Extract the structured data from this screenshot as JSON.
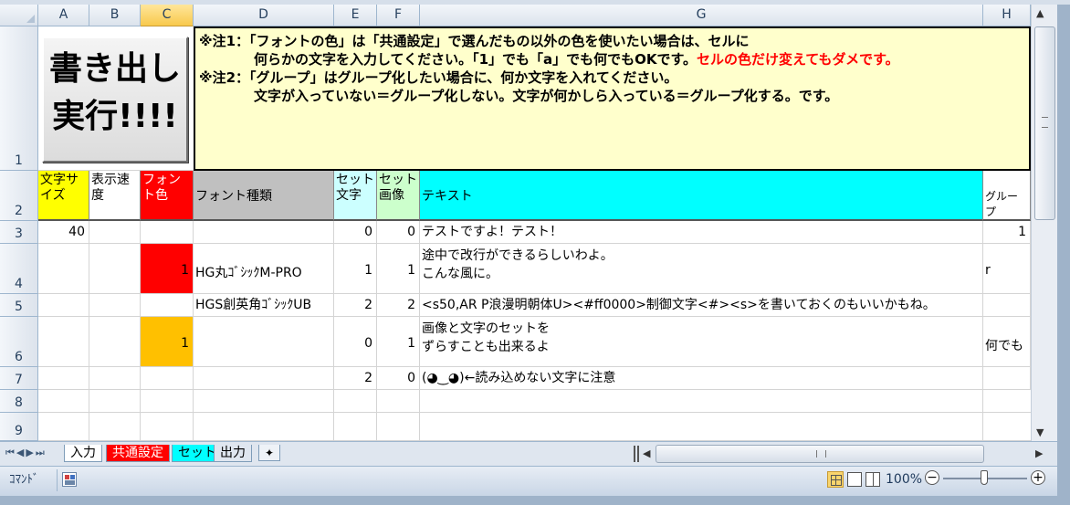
{
  "columns": [
    "A",
    "B",
    "C",
    "D",
    "E",
    "F",
    "G",
    "H"
  ],
  "rows": [
    "1",
    "2",
    "3",
    "4",
    "5",
    "6",
    "7",
    "8",
    "9"
  ],
  "button": {
    "line1": "書き出し",
    "line2": "実行!!!!"
  },
  "notes": {
    "line1": "※注1：「フォントの色」は「共通設定」で選んだもの以外の色を使いたい場合は、セルに",
    "line2a": "　　　　何らかの文字を入力してください。「1」でも「a」でも何でもOKです。",
    "line2b": "セルの色だけ変えてもダメです。",
    "line3": "※注2：「グループ」はグループ化したい場合に、何か文字を入れてください。",
    "line4": "　　　　文字が入っていない＝グループ化しない。文字が何かしら入っている＝グループ化する。です。"
  },
  "headers": {
    "a": "文字サイズ",
    "b": "表示速度",
    "c": "フォント色",
    "d": "フォント種類",
    "e": "セット文字",
    "f": "セット画像",
    "g": "テキスト",
    "h": "グループ"
  },
  "data_rows": [
    {
      "a": "40",
      "b": "",
      "c": "",
      "d": "",
      "e": "0",
      "f": "0",
      "g1": "テストですよ！テスト！",
      "g2": "",
      "h": "1"
    },
    {
      "a": "",
      "b": "",
      "c": "1",
      "d": "HG丸ｺﾞｼｯｸM-PRO",
      "e": "1",
      "f": "1",
      "g1": "途中で改行ができるらしいわよ。",
      "g2": "こんな風に。",
      "h": "r"
    },
    {
      "a": "",
      "b": "",
      "c": "",
      "d": "HGS創英角ｺﾞｼｯｸUB",
      "e": "2",
      "f": "2",
      "g1": "<s50,AR P浪漫明朝体U><#ff0000>制御文字<#><s>を書いておくのもいいかもね。",
      "g2": "",
      "h": ""
    },
    {
      "a": "",
      "b": "",
      "c": "1",
      "d": "",
      "e": "0",
      "f": "1",
      "g1": "画像と文字のセットを",
      "g2": "ずらすことも出来るよ",
      "h": "何でも"
    },
    {
      "a": "",
      "b": "",
      "c": "",
      "d": "",
      "e": "2",
      "f": "0",
      "g1": "(◕‿◕)←読み込めない文字に注意",
      "g2": "",
      "h": ""
    }
  ],
  "tabs": [
    "入力",
    "共通設定",
    "セット",
    "出力"
  ],
  "status": {
    "mode": "ｺﾏﾝﾄﾞ",
    "zoom": "100%"
  },
  "colors": {
    "red": "#ff0000",
    "orange": "#ffc000",
    "yellow": "#ffff00",
    "cyan": "#00ffff",
    "light_cyan": "#ccffff",
    "note_bg": "#ffffcc",
    "grey": "#c0c0c0"
  }
}
